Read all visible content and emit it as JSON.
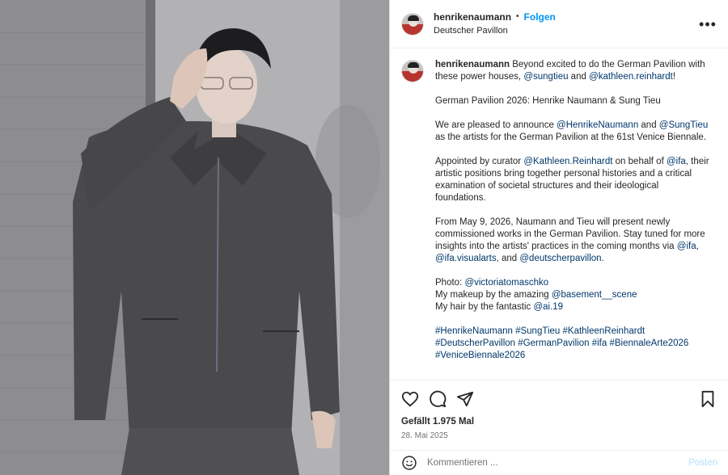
{
  "header": {
    "username": "henrikenaumann",
    "separator": "•",
    "follow_label": "Folgen",
    "location": "Deutscher Pavillon",
    "more_glyph": "•••",
    "more_icon": "more-options-icon"
  },
  "caption": {
    "username": "henrikenaumann",
    "intro_text": " Beyond excited to do the German Pavilion with these power houses, ",
    "intro_mention_1": "@sungtieu",
    "intro_and": " and ",
    "intro_mention_2": "@kathleen.reinhardt",
    "intro_end": "!",
    "headline": "German Pavilion 2026: Henrike Naumann & Sung Tieu",
    "p2_a": "We are pleased to announce ",
    "p2_m1": "@HenrikeNaumann",
    "p2_b": " and ",
    "p2_m2": "@SungTieu",
    "p2_c": " as the artists for the German Pavilion at the 61st Venice Biennale.",
    "p3_a": "Appointed by curator ",
    "p3_m1": "@Kathleen.Reinhardt",
    "p3_b": " on behalf of ",
    "p3_m2": "@ifa",
    "p3_c": ", their artistic positions bring together personal histories and a critical examination of societal structures and their ideological foundations.",
    "p4_a": "From May 9, 2026, Naumann and Tieu will present newly commissioned works in the German Pavilion. Stay tuned for more insights into the artists' practices in the coming months via ",
    "p4_m1": "@ifa",
    "p4_b": ", ",
    "p4_m2": "@ifa.visualarts",
    "p4_c": ", and ",
    "p4_m3": "@deutscherpavillon",
    "p4_d": ".",
    "photo_label": "Photo: ",
    "photo_mention": "@victoriatomaschko",
    "makeup_label": "My makeup by the amazing ",
    "makeup_mention": "@basement__scene",
    "hair_label": "My hair by the fantastic ",
    "hair_mention": "@ai.19",
    "hashtags": [
      "#HenrikeNaumann",
      "#SungTieu",
      "#KathleenReinhardt",
      "#DeutscherPavillon",
      "#GermanPavilion",
      "#ifa",
      "#BiennaleArte2026",
      "#VeniceBiennale2026"
    ]
  },
  "actions": {
    "like_icon": "heart-icon",
    "comment_icon": "comment-icon",
    "share_icon": "share-icon",
    "save_icon": "bookmark-icon"
  },
  "likes_text": "Gefällt 1.975 Mal",
  "date_text": "28. Mai 2025",
  "comment": {
    "placeholder": "Kommentieren ...",
    "value": "",
    "post_label": "Posten",
    "emoji_icon": "emoji-icon"
  },
  "colors": {
    "link": "#00376b",
    "follow": "#0095f6",
    "post_disabled": "#b2dffc",
    "muted": "#737373"
  }
}
